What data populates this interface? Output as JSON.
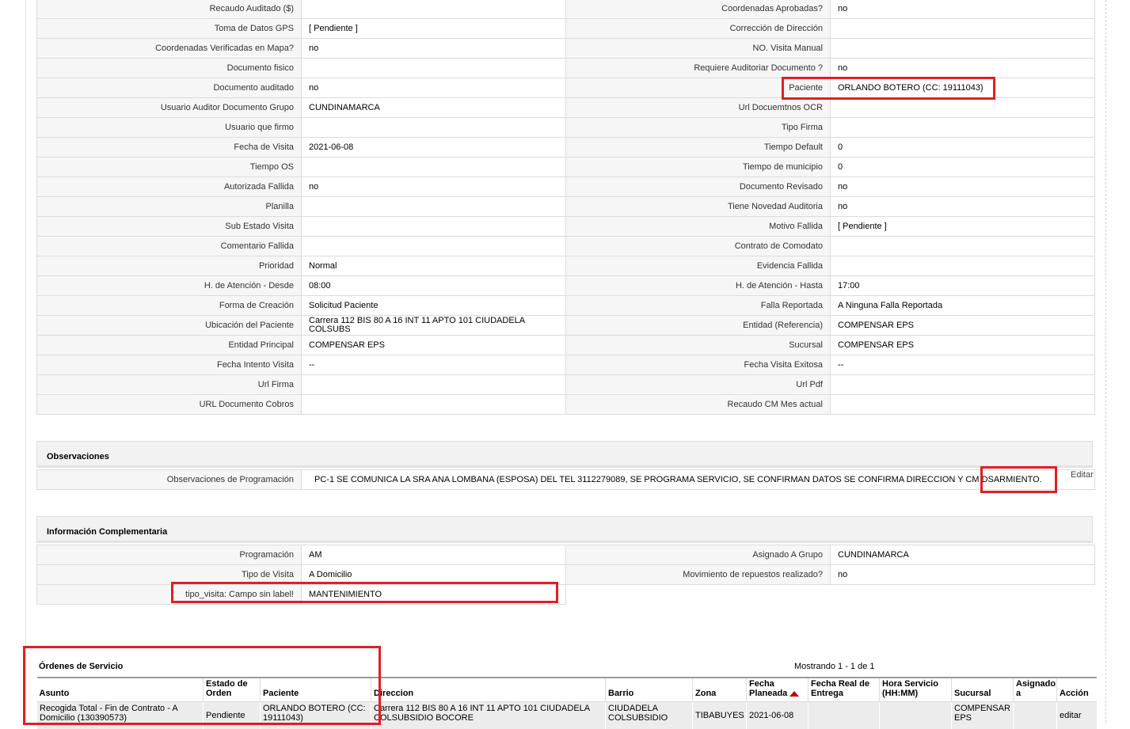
{
  "details": [
    [
      "Recaudo Auditado ($)",
      "",
      "Coordenadas Aprobadas?",
      "no"
    ],
    [
      "Toma de Datos GPS",
      "[ Pendiente ]",
      "Corrección de Dirección",
      ""
    ],
    [
      "Coordenadas Verificadas en Mapa?",
      "no",
      "NO. Visita Manual",
      ""
    ],
    [
      "Documento fisico",
      "",
      "Requiere Auditoriar Documento ?",
      "no"
    ],
    [
      "Documento auditado",
      "no",
      "Paciente",
      "ORLANDO BOTERO (CC: 19111043)"
    ],
    [
      "Usuario Auditor Documento Grupo",
      "CUNDINAMARCA",
      "Url Docuemtnos OCR",
      ""
    ],
    [
      "Usuario que firmo",
      "",
      "Tipo Firma",
      ""
    ],
    [
      "Fecha de Visita",
      "2021-06-08",
      "Tiempo Default",
      "0"
    ],
    [
      "Tiempo OS",
      "",
      "Tiempo de municipio",
      "0"
    ],
    [
      "Autorizada Fallida",
      "no",
      "Documento Revisado",
      "no"
    ],
    [
      "Planilla",
      "",
      "Tiene Novedad Auditoria",
      "no"
    ],
    [
      "Sub Estado Visita",
      "",
      "Motivo Fallida",
      "[ Pendiente ]"
    ],
    [
      "Comentario Fallida",
      "",
      "Contrato de Comodato",
      ""
    ],
    [
      "Prioridad",
      "Normal",
      "Evidencia Fallida",
      ""
    ],
    [
      "H. de Atención - Desde",
      "08:00",
      "H. de Atención - Hasta",
      "17:00"
    ],
    [
      "Forma de Creación",
      "Solicitud Paciente",
      "Falla Reportada",
      "A Ninguna Falla Reportada"
    ],
    [
      "Ubicación del Paciente",
      "Carrera 112 BIS 80 A 16 INT 11 APTO 101 CIUDADELA COLSUBS",
      "Entidad (Referencia)",
      "COMPENSAR EPS"
    ],
    [
      "Entidad Principal",
      "COMPENSAR EPS",
      "Sucursal",
      "COMPENSAR EPS"
    ],
    [
      "Fecha Intento Visita",
      "--",
      "Fecha Visita Exitosa",
      "--"
    ],
    [
      "Url Firma",
      "",
      "Url Pdf",
      ""
    ],
    [
      "URL Documento Cobros",
      "",
      "Recaudo CM Mes actual",
      ""
    ]
  ],
  "observaciones": {
    "title": "Observaciones",
    "label": "Observaciones de Programación",
    "value": "PC-1 SE COMUNICA LA SRA ANA LOMBANA (ESPOSA) DEL TEL 3112279089, SE PROGRAMA SERVICIO, SE CONFIRMAN DATOS SE CONFIRMA DIRECCION Y CM DSARMIENTO.",
    "edit_label": "Editar"
  },
  "info": {
    "title": "Información Complementaria",
    "rows": [
      [
        "Programación",
        "AM",
        "Asignado A Grupo",
        "CUNDINAMARCA"
      ],
      [
        "Tipo de Visita",
        "A Domicilio",
        "Movimiento de repuestos realizado?",
        "no"
      ]
    ],
    "extra_label": "tipo_visita: Campo sin label!",
    "extra_value": "MANTENIMIENTO"
  },
  "orders": {
    "title": "Órdenes de Servicio",
    "showing": "Mostrando 1 - 1 de 1",
    "headers": [
      "Asunto",
      "Estado de Orden",
      "Paciente",
      "Direccion",
      "Barrio",
      "Zona",
      "Fecha Planeada",
      "Fecha Real de Entrega",
      "Hora Servicio (HH:MM)",
      "Sucursal",
      "Asignado a",
      "Acción"
    ],
    "row": {
      "asunto": "Recogida Total - Fin de Contrato - A Domicilio (130390573)",
      "estado": "Pendiente",
      "paciente": "ORLANDO BOTERO (CC: 19111043)",
      "direccion": "Carrera 112 BIS 80 A 16 INT 11 APTO 101 CIUDADELA COLSUBSIDIO BOCORE",
      "barrio": "CIUDADELA COLSUBSIDIO",
      "zona": "TIBABUYES",
      "fecha_planeada": "2021-06-08",
      "fecha_real": "",
      "hora": "",
      "sucursal": "COMPENSAR EPS",
      "asignado": "",
      "accion": "editar"
    }
  },
  "colors": {
    "highlight": "#e02020",
    "sort_arrow": "#cc0000"
  }
}
